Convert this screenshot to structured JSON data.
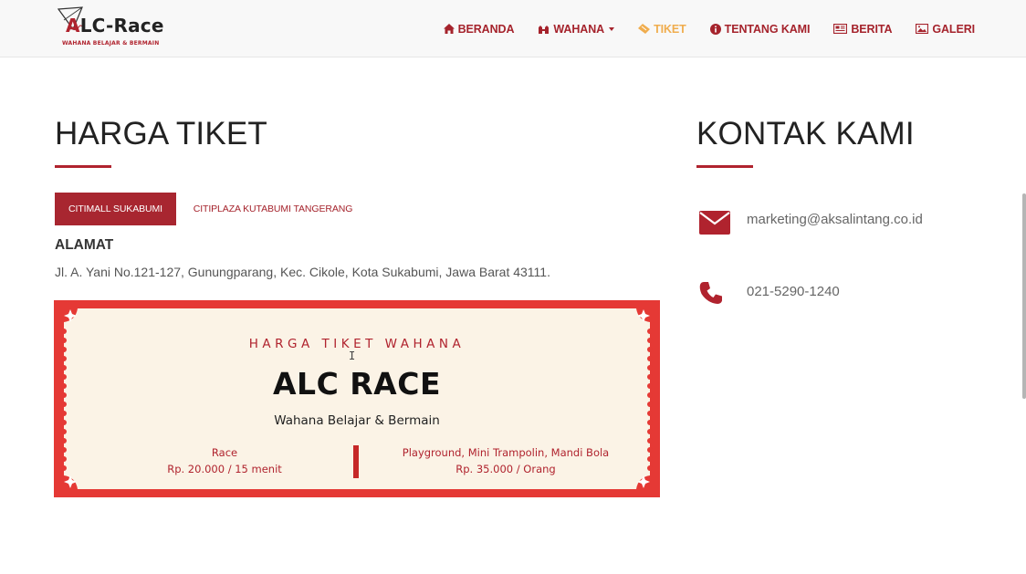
{
  "brand": {
    "logo_text_a": "A",
    "logo_text_rest": "LC-Race",
    "tagline": "WAHANA BELAJAR & BERMAIN",
    "accent_color": "#b0232e"
  },
  "nav": {
    "items": [
      {
        "label": "BERANDA",
        "icon": "home-icon"
      },
      {
        "label": "WAHANA",
        "icon": "attraction-icon",
        "dropdown": true
      },
      {
        "label": "TIKET",
        "icon": "ticket-icon",
        "active": true
      },
      {
        "label": "TENTANG KAMI",
        "icon": "info-icon"
      },
      {
        "label": "BERITA",
        "icon": "newspaper-icon"
      },
      {
        "label": "GALERI",
        "icon": "image-icon"
      }
    ]
  },
  "ticket_section": {
    "heading": "HARGA TIKET",
    "tabs": [
      {
        "label": "CITIMALL SUKABUMI",
        "active": true
      },
      {
        "label": "CITIPLAZA KUTABUMI TANGERANG",
        "active": false
      }
    ],
    "address_label": "ALAMAT",
    "address_value": "Jl. A. Yani No.121-127, Gunungparang, Kec. Cikole, Kota Sukabumi, Jawa Barat 43111.",
    "ticket": {
      "title": "HARGA TIKET WAHANA",
      "name": "ALC RACE",
      "subtitle": "Wahana Belajar & Bermain",
      "left_item": "Race",
      "left_price": "Rp. 20.000 / 15 menit",
      "right_item": "Playground, Mini Trampolin, Mandi Bola",
      "right_price": "Rp. 35.000 / Orang",
      "frame_color": "#e53935",
      "paper_color": "#fbf3e6"
    }
  },
  "contact_section": {
    "heading": "KONTAK KAMI",
    "email": "marketing@aksalintang.co.id",
    "phone": "021-5290-1240"
  }
}
